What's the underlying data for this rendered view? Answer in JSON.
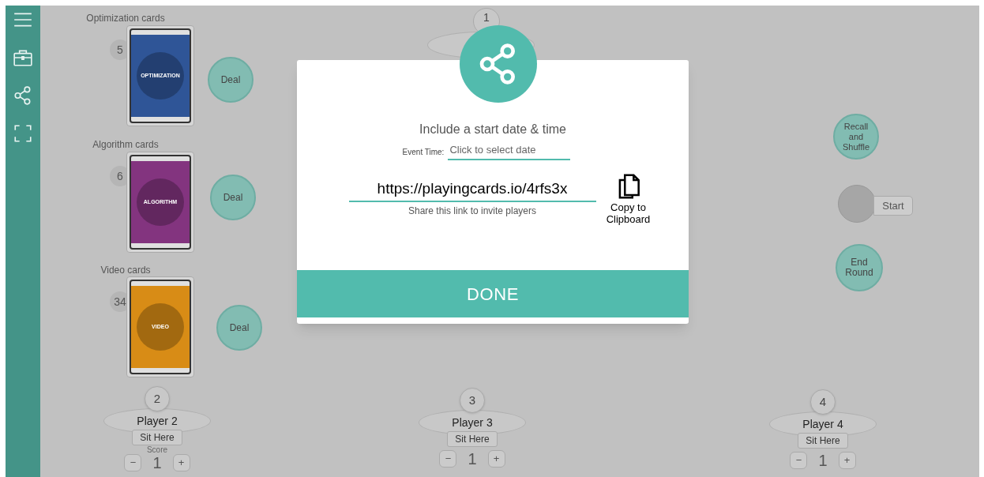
{
  "sidebar": {
    "items": [
      {
        "kind": "menu"
      },
      {
        "kind": "briefcase"
      },
      {
        "kind": "share"
      },
      {
        "kind": "fullscreen"
      }
    ]
  },
  "decks": [
    {
      "title": "Optimization cards",
      "count": "5",
      "card_label": "OPTIMIZATION",
      "color": "#2f5597",
      "deal": "Deal"
    },
    {
      "title": "Algorithm cards",
      "count": "6",
      "card_label": "ALGORITHM",
      "color": "#83347f",
      "deal": "Deal"
    },
    {
      "title": "Video cards",
      "count": "34",
      "card_label": "VIDEO",
      "color": "#d88c16",
      "deal": "Deal"
    }
  ],
  "top_seat": {
    "number": "1"
  },
  "players": [
    {
      "number": "2",
      "name": "Player 2",
      "sit": "Sit Here",
      "score_label": "Score",
      "minus": "−",
      "score": "1",
      "plus": "+"
    },
    {
      "number": "3",
      "name": "Player 3",
      "sit": "Sit Here",
      "minus": "−",
      "score": "1",
      "plus": "+"
    },
    {
      "number": "4",
      "name": "Player 4",
      "sit": "Sit Here",
      "minus": "−",
      "score": "1",
      "plus": "+"
    }
  ],
  "controls": {
    "recall": "Recall and Shuffle",
    "start": "Start",
    "end": "End Round"
  },
  "modal": {
    "heading": "Include a start date & time",
    "event_label": "Event Time:",
    "event_placeholder": "Click to select date",
    "link": "https://playingcards.io/4rfs3x",
    "link_hint": "Share this link to invite players",
    "copy": "Copy to Clipboard",
    "done": "DONE"
  }
}
